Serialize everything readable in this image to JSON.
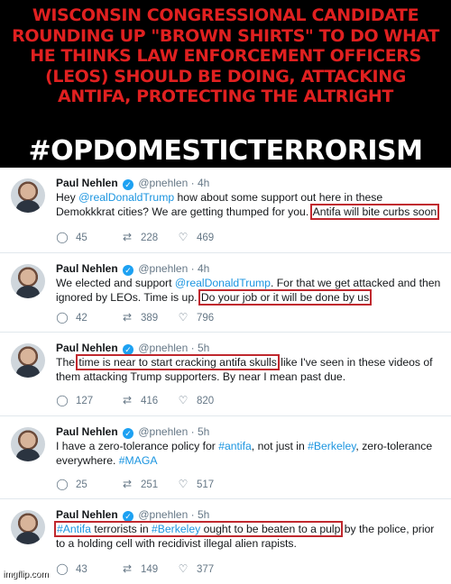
{
  "header": {
    "headline": "WISCONSIN CONGRESSIONAL CANDIDATE ROUNDING UP \"BROWN SHIRTS\" TO DO WHAT HE THINKS LAW ENFORCEMENT OFFICERS (LEOS) SHOULD BE DOING, ATTACKING ANTIFA, PROTECTING THE ALTRIGHT",
    "hashtag": "#OPDOMESTICTERRORISM"
  },
  "tweets": [
    {
      "name": "Paul Nehlen",
      "handle": "@pnehlen",
      "time": "· 4h",
      "t1": "Hey ",
      "t2": "@realDonaldTrump",
      "t3": " how about some support out here in these Demokkkrat cities? We are getting thumped for you. ",
      "t4": "Antifa will bite curbs soon",
      "replies": "45",
      "retweets": "228",
      "likes": "469"
    },
    {
      "name": "Paul Nehlen",
      "handle": "@pnehlen",
      "time": "· 4h",
      "t1": "We elected and support ",
      "t2": "@realDonaldTrump",
      "t3": ". For that we get attacked and then ignored by LEOs. Time is up. ",
      "t4": "Do your job or it will be done by us",
      "replies": "42",
      "retweets": "389",
      "likes": "796"
    },
    {
      "name": "Paul Nehlen",
      "handle": "@pnehlen",
      "time": "· 5h",
      "t1": "The ",
      "t2": "time is near to start cracking antifa skulls",
      "t3": " like I've seen in these videos of them attacking Trump supporters. By near I mean past due.",
      "replies": "127",
      "retweets": "416",
      "likes": "820"
    },
    {
      "name": "Paul Nehlen",
      "handle": "@pnehlen",
      "time": "· 5h",
      "t1": "I have a zero-tolerance policy for ",
      "t2": "#antifa",
      "t3": ", not just in ",
      "t4": "#Berkeley",
      "t5": ", zero-tolerance everywhere. ",
      "t6": "#MAGA",
      "replies": "25",
      "retweets": "251",
      "likes": "517"
    },
    {
      "name": "Paul Nehlen",
      "handle": "@pnehlen",
      "time": "· 5h",
      "t1": "#Antifa",
      "t2": " terrorists in ",
      "t3": "#Berkeley",
      "t4": " ought to be beaten to a pulp",
      "t5": " by the police, prior to a holding cell with recidivist illegal alien rapists.",
      "replies": "43",
      "retweets": "149",
      "likes": "377"
    }
  ],
  "watermark": "imgflip.com",
  "icons": [
    "reply-icon",
    "retweet-icon",
    "like-icon",
    "verified-icon"
  ],
  "colors": {
    "headline": "#e02020",
    "highlight_box": "#c0282e",
    "link": "#1b95e0",
    "verified": "#1da1f2"
  }
}
